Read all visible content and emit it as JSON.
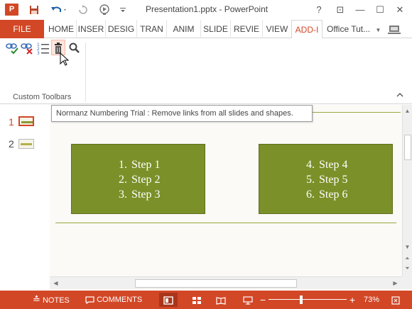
{
  "app": {
    "title": "Presentation1.pptx - PowerPoint",
    "logo_letter": "P"
  },
  "window_controls": {
    "help": "?",
    "ribbon_options": "⊡",
    "minimize": "—",
    "maximize": "☐",
    "close": "✕"
  },
  "ribbon_tabs": {
    "file": "FILE",
    "items": [
      "HOME",
      "INSER",
      "DESIG",
      "TRAN",
      "ANIM",
      "SLIDE",
      "REVIE",
      "VIEW",
      "ADD-I"
    ],
    "active": "ADD-I",
    "user": "Office Tut..."
  },
  "ribbon": {
    "group_label": "Custom Toolbars",
    "tool_icons": [
      "link-check-icon",
      "link-remove-icon",
      "numbering-icon",
      "trash-icon",
      "search-icon"
    ]
  },
  "tooltip": {
    "text": "Normanz Numbering Trial : Remove links from all slides and shapes."
  },
  "thumbnails": [
    {
      "number": "1",
      "selected": true
    },
    {
      "number": "2",
      "selected": false
    }
  ],
  "slide": {
    "boxes": [
      {
        "items": [
          {
            "num": "1.",
            "text": "Step 1"
          },
          {
            "num": "2.",
            "text": "Step 2"
          },
          {
            "num": "3.",
            "text": "Step 3"
          }
        ]
      },
      {
        "items": [
          {
            "num": "4.",
            "text": "Step 4"
          },
          {
            "num": "5.",
            "text": "Step 5"
          },
          {
            "num": "6.",
            "text": "Step 6"
          }
        ]
      }
    ]
  },
  "statusbar": {
    "notes": "NOTES",
    "comments": "COMMENTS",
    "zoom_minus": "−",
    "zoom_plus": "+",
    "zoom_percent": "73%",
    "zoom_level": 0.73
  },
  "colors": {
    "accent": "#d24726",
    "box_fill": "#7b9028",
    "slide_line": "#9aa43d"
  }
}
